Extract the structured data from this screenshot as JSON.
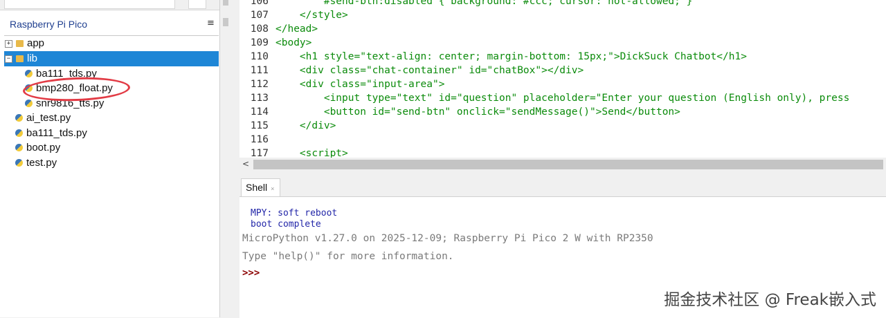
{
  "files_panel": {
    "title": "Raspberry Pi Pico",
    "menu_icon": "≡",
    "tree": [
      {
        "label": "app",
        "kind": "folder",
        "expander": "+"
      },
      {
        "label": "lib",
        "kind": "folder",
        "expander": "−",
        "selected": true
      },
      {
        "label": "ba111_tds.py",
        "kind": "file"
      },
      {
        "label": "bmp280_float.py",
        "kind": "file",
        "highlighted": true
      },
      {
        "label": "snr9816_tts.py",
        "kind": "file"
      },
      {
        "label": "ai_test.py",
        "kind": "file"
      },
      {
        "label": "ba111_tds.py",
        "kind": "file"
      },
      {
        "label": "boot.py",
        "kind": "file"
      },
      {
        "label": "test.py",
        "kind": "file"
      }
    ]
  },
  "editor": {
    "lines": [
      {
        "num": "106",
        "text": "        #send-btn:disabled { background: #ccc; cursor: not-allowed; }"
      },
      {
        "num": "107",
        "text": "    </style>"
      },
      {
        "num": "108",
        "text": "</head>"
      },
      {
        "num": "109",
        "text": "<body>"
      },
      {
        "num": "110",
        "text": "    <h1 style=\"text-align: center; margin-bottom: 15px;\">DickSuck Chatbot</h1>"
      },
      {
        "num": "111",
        "text": "    <div class=\"chat-container\" id=\"chatBox\"></div>"
      },
      {
        "num": "112",
        "text": "    <div class=\"input-area\">"
      },
      {
        "num": "113",
        "text": "        <input type=\"text\" id=\"question\" placeholder=\"Enter your question (English only), press"
      },
      {
        "num": "114",
        "text": "        <button id=\"send-btn\" onclick=\"sendMessage()\">Send</button>"
      },
      {
        "num": "115",
        "text": "    </div>"
      },
      {
        "num": "116",
        "text": ""
      },
      {
        "num": "117",
        "text": "    <script>"
      }
    ],
    "scroll_left_icon": "<"
  },
  "shell": {
    "tab_label": "Shell",
    "tab_close": "×",
    "lines": [
      {
        "text": "MPY: soft reboot",
        "style": "blue"
      },
      {
        "text": "boot complete",
        "style": "blue"
      },
      {
        "text": "MicroPython v1.27.0 on 2025-12-09; Raspberry Pi Pico 2 W with RP2350",
        "style": "gray"
      },
      {
        "text": "Type \"help()\" for more information.",
        "style": "gray"
      }
    ],
    "prompt": ">>>"
  },
  "watermark": "掘金技术社区 @ Freak嵌入式"
}
